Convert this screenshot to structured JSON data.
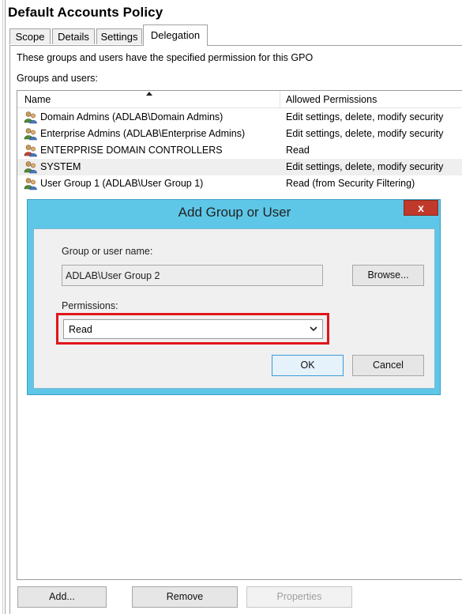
{
  "window": {
    "title": "Default Accounts Policy"
  },
  "tabs": [
    {
      "label": "Scope",
      "active": false
    },
    {
      "label": "Details",
      "active": false
    },
    {
      "label": "Settings",
      "active": false
    },
    {
      "label": "Delegation",
      "active": true
    }
  ],
  "delegation": {
    "description": "These groups and users have the specified permission for this GPO",
    "groups_label": "Groups and users:",
    "columns": {
      "name": "Name",
      "permissions": "Allowed Permissions"
    },
    "rows": [
      {
        "name": "Domain Admins (ADLAB\\Domain Admins)",
        "permission": "Edit settings, delete, modify security"
      },
      {
        "name": "Enterprise Admins (ADLAB\\Enterprise Admins)",
        "permission": "Edit settings, delete, modify security"
      },
      {
        "name": "ENTERPRISE DOMAIN CONTROLLERS",
        "permission": "Read"
      },
      {
        "name": "SYSTEM",
        "permission": "Edit settings, delete, modify security"
      },
      {
        "name": "User Group 1 (ADLAB\\User Group 1)",
        "permission": "Read (from Security Filtering)"
      }
    ],
    "buttons": {
      "add": "Add...",
      "remove": "Remove",
      "properties": "Properties"
    }
  },
  "dialog": {
    "title": "Add Group or User",
    "close": "x",
    "name_label": "Group or user name:",
    "name_value": "ADLAB\\User Group 2",
    "browse": "Browse...",
    "permissions_label": "Permissions:",
    "permission_selected": "Read",
    "ok": "OK",
    "cancel": "Cancel"
  },
  "icons": {
    "user_group": "user-group-icon",
    "dropdown": "chevron-down-icon"
  },
  "colors": {
    "dialog_frame": "#5ec7e8",
    "highlight": "#e0161b",
    "close": "#c0392b"
  }
}
